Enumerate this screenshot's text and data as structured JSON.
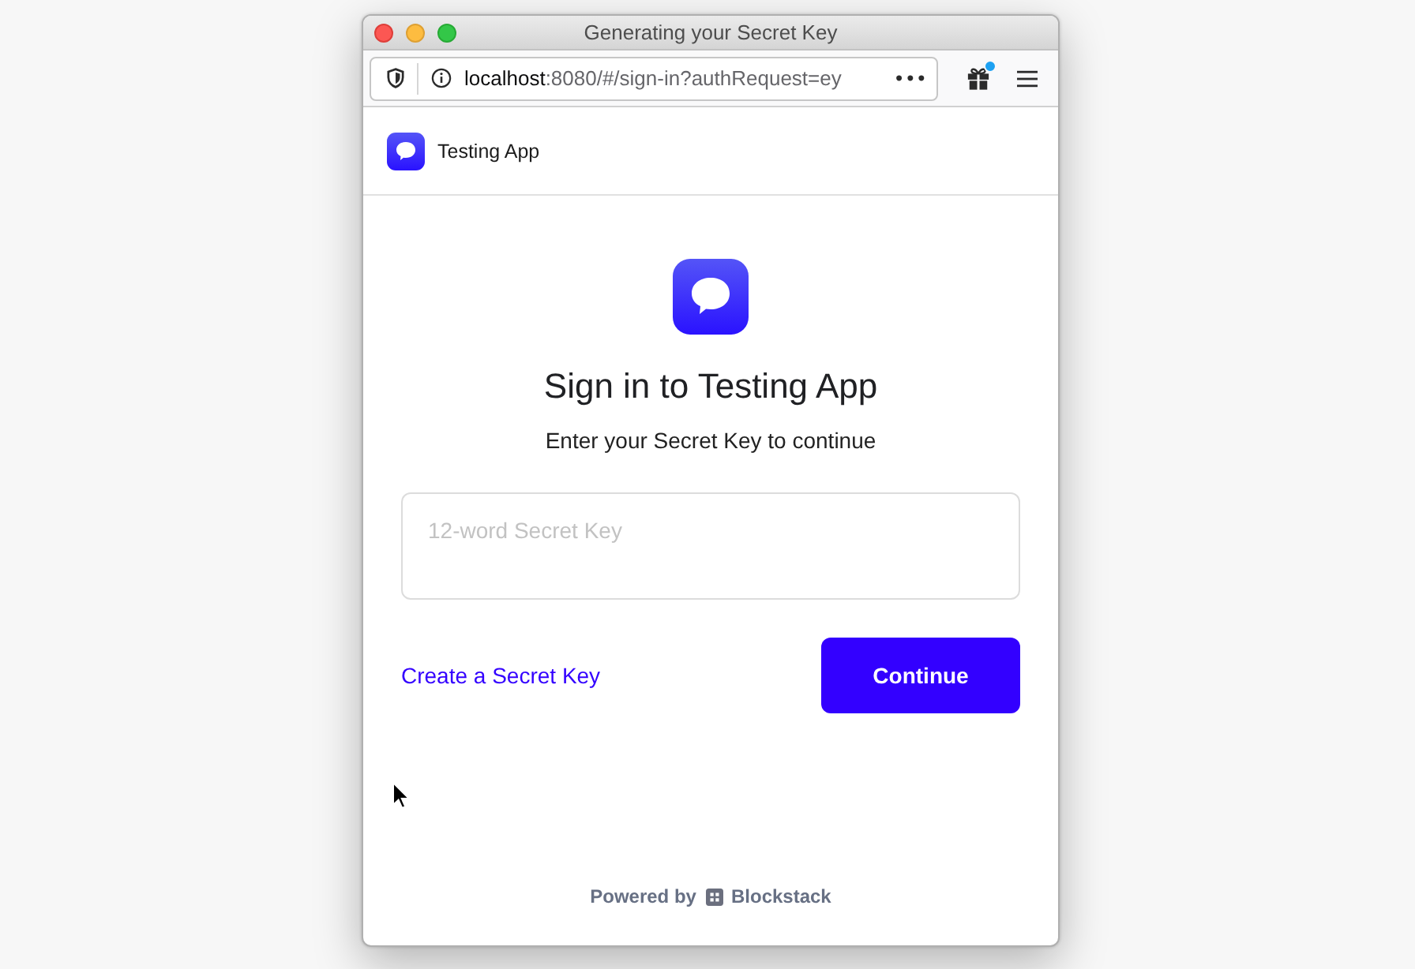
{
  "window": {
    "title": "Generating your Secret Key"
  },
  "toolbar": {
    "url_host": "localhost",
    "url_path": ":8080/#/sign-in?authRequest=ey",
    "page_actions": "•••",
    "gift_unread": true
  },
  "app_header": {
    "app_name": "Testing App"
  },
  "sign_in": {
    "title": "Sign in to Testing App",
    "subtitle": "Enter your Secret Key to continue",
    "secret_key_field": {
      "placeholder": "12-word Secret Key"
    },
    "create_link": "Create a Secret Key",
    "continue_button": "Continue"
  },
  "footer": {
    "powered_by": "Powered by",
    "brand": "Blockstack"
  }
}
